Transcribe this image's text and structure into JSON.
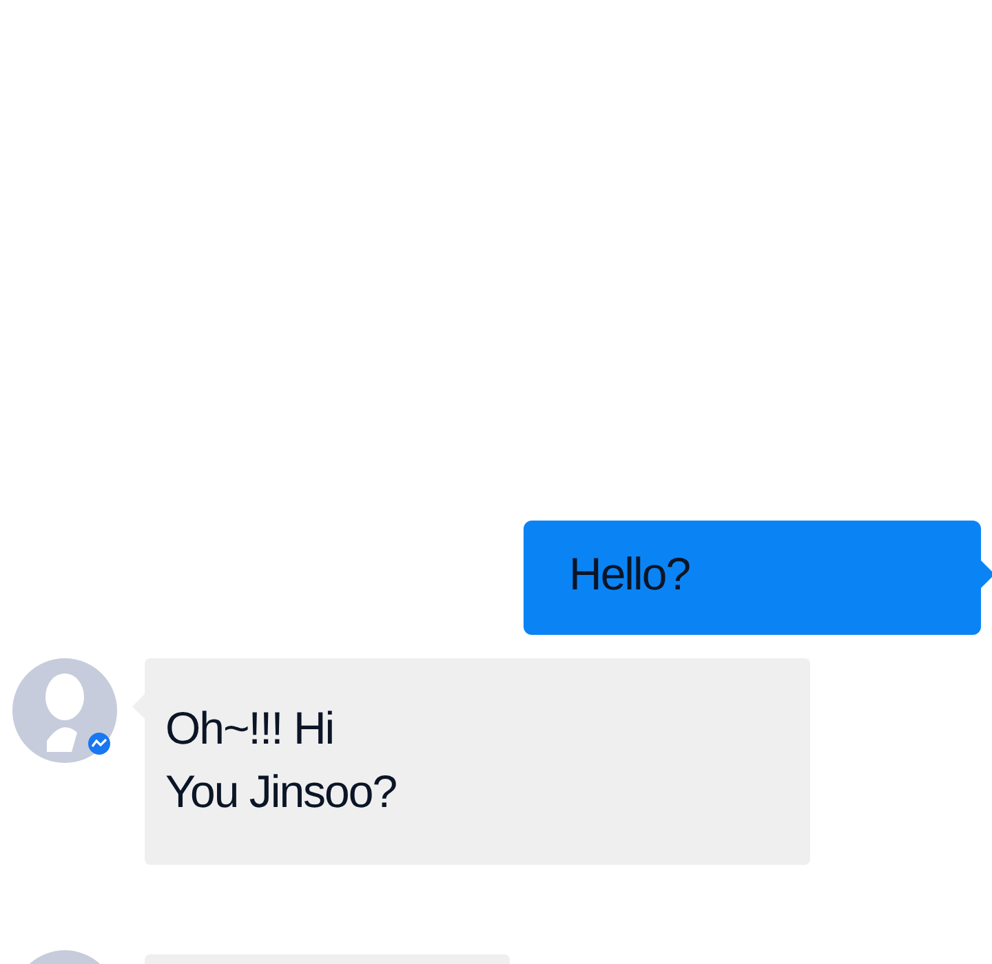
{
  "messages": [
    {
      "kind": "outgoing",
      "lines": [
        "Hello?"
      ]
    },
    {
      "kind": "incoming",
      "lines": [
        "Oh~!!! Hi",
        "You Jinsoo?"
      ]
    },
    {
      "kind": "incoming"
    }
  ]
}
